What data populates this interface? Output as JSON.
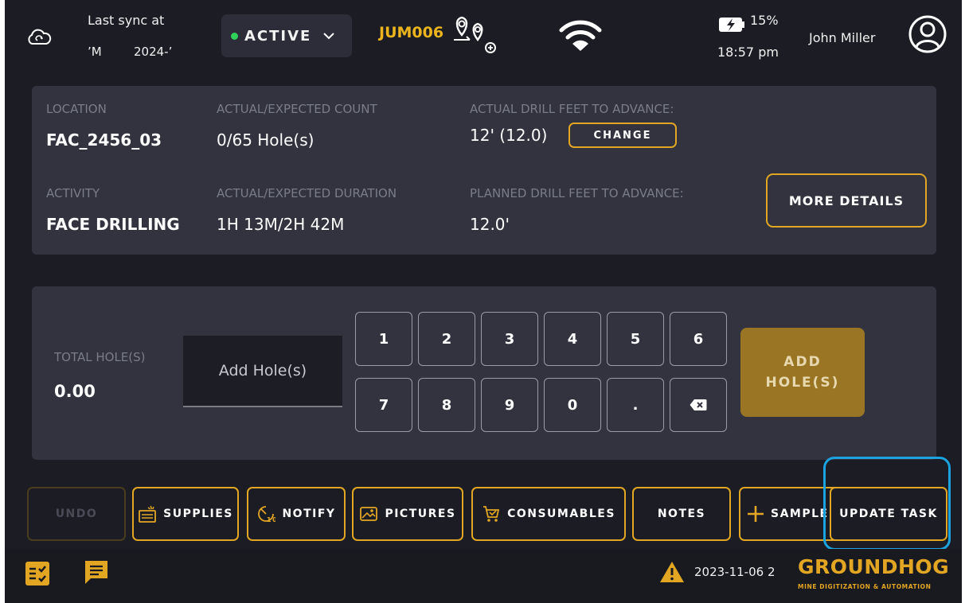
{
  "topbar": {
    "sync_label": "Last sync at",
    "sync_time": "’M",
    "sync_date": "2024-’",
    "status": "ACTIVE",
    "machine_id": "JUM006",
    "battery_percent": "15%",
    "clock": "18:57 pm",
    "user_name": "John Miller"
  },
  "info": {
    "location_label": "LOCATION",
    "location_value": "FAC_2456_03",
    "count_label": "ACTUAL/EXPECTED COUNT",
    "count_value": "0/65 Hole(s)",
    "drill_label": "ACTUAL DRILL FEET TO ADVANCE:",
    "drill_value": "12' (12.0)",
    "change_label": "CHANGE",
    "activity_label": "ACTIVITY",
    "activity_value": "FACE DRILLING",
    "duration_label": "ACTUAL/EXPECTED DURATION",
    "duration_value": "1H 13M/2H 42M",
    "planned_label": "PLANNED DRILL FEET TO ADVANCE:",
    "planned_value": "12.0'",
    "more_details_label": "MORE DETAILS"
  },
  "keypad": {
    "total_label": "TOTAL HOLE(S)",
    "total_value": "0.00",
    "input_placeholder": "Add Hole(s)",
    "keys_row1": [
      "1",
      "2",
      "3",
      "4",
      "5",
      "6"
    ],
    "keys_row2": [
      "7",
      "8",
      "9",
      "0",
      "."
    ],
    "add_label_line1": "ADD",
    "add_label_line2": "HOLE(S)"
  },
  "actions": {
    "undo": "UNDO",
    "supplies": "SUPPLIES",
    "notify": "NOTIFY",
    "pictures": "PICTURES",
    "consumables": "CONSUMABLES",
    "notes": "NOTES",
    "sample": "SAMPLE",
    "update_task": "UPDATE TASK"
  },
  "bottombar": {
    "warning_date": "2023-11-06 2",
    "brand": "GROUNDHOG",
    "brand_tagline": "MINE DIGITIZATION & AUTOMATION"
  },
  "colors": {
    "accent": "#e2a623",
    "background": "#1c1c24",
    "card": "#32333e",
    "status_active": "#2fd15b",
    "highlight": "#1aa3df"
  }
}
